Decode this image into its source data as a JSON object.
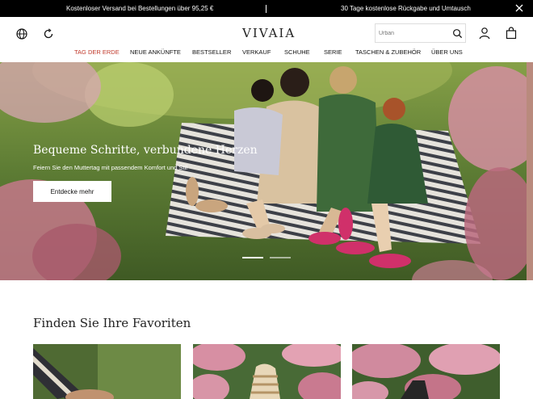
{
  "announcement": {
    "left": "Kostenloser Versand bei Bestellungen über 95,25 €",
    "right": "30 Tage kostenlose Rückgabe und Umtausch"
  },
  "header": {
    "logo": "VIVAIA",
    "search_placeholder": "Urban",
    "icons": [
      "globe-icon",
      "sync-icon",
      "search-icon",
      "user-icon",
      "bag-icon"
    ]
  },
  "nav": {
    "items": [
      {
        "label": "TAG DER ERDE",
        "highlight": true
      },
      {
        "label": "NEUE ANKÜNFTE"
      },
      {
        "label": "BESTSELLER"
      },
      {
        "label": "VERKAUF"
      },
      {
        "label": "SCHUHE"
      },
      {
        "label": "SERIE"
      },
      {
        "label": "TASCHEN & ZUBEHÖR"
      },
      {
        "label": "ÜBER UNS"
      }
    ]
  },
  "hero": {
    "title": "Bequeme Schritte, verbundene Herzen",
    "subtitle": "Feiern Sie den Muttertag mit passendem Komfort und Stil",
    "cta": "Entdecke mehr",
    "slides_total": 2,
    "active_slide": 1
  },
  "favorites": {
    "title": "Finden Sie Ihre Favoriten"
  },
  "colors": {
    "topbar_bg": "#000000",
    "nav_highlight": "#c0392b",
    "grass": "#5f7e3c",
    "pink_shoe": "#d0306a"
  }
}
